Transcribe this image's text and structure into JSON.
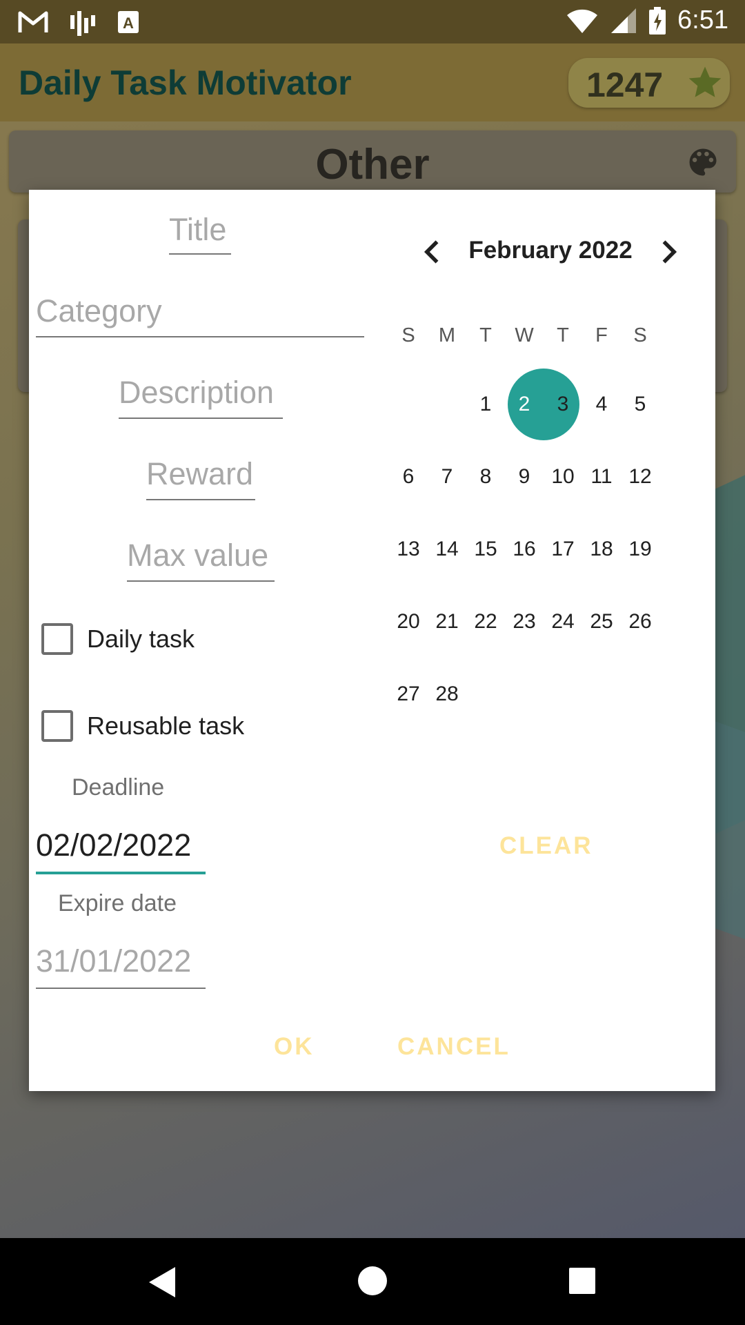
{
  "status_bar": {
    "time": "6:51"
  },
  "app_bar": {
    "title": "Daily Task Motivator",
    "score": "1247"
  },
  "category": {
    "name": "Other"
  },
  "dialog": {
    "title_placeholder": "Title",
    "category_placeholder": "Category",
    "description_placeholder": "Description",
    "reward_placeholder": "Reward",
    "max_value_placeholder": "Max value",
    "daily_task_label": "Daily task",
    "reusable_task_label": "Reusable task",
    "deadline_label": "Deadline",
    "deadline_value": "02/02/2022",
    "expire_label": "Expire date",
    "expire_value": "31/01/2022",
    "clear_label": "CLEAR",
    "ok_label": "OK",
    "cancel_label": "CANCEL"
  },
  "calendar": {
    "month_label": "February 2022",
    "weekdays": [
      "S",
      "M",
      "T",
      "W",
      "T",
      "F",
      "S"
    ],
    "selected_day": "2",
    "days": [
      "1",
      "2",
      "3",
      "4",
      "5",
      "6",
      "7",
      "8",
      "9",
      "10",
      "11",
      "12",
      "13",
      "14",
      "15",
      "16",
      "17",
      "18",
      "19",
      "20",
      "21",
      "22",
      "23",
      "24",
      "25",
      "26",
      "27",
      "28"
    ]
  },
  "colors": {
    "accent": "#26a095",
    "button_text": "#fde49a",
    "app_bar": "#7d6b35",
    "status_bar": "#574a24"
  },
  "icons": [
    "gmail-icon",
    "signal-bars-icon",
    "text-a-icon",
    "wifi-icon",
    "cell-signal-icon",
    "battery-charging-icon",
    "star-icon",
    "palette-icon",
    "chevron-left-icon",
    "chevron-right-icon",
    "back-nav-icon",
    "home-nav-icon",
    "recents-nav-icon"
  ]
}
